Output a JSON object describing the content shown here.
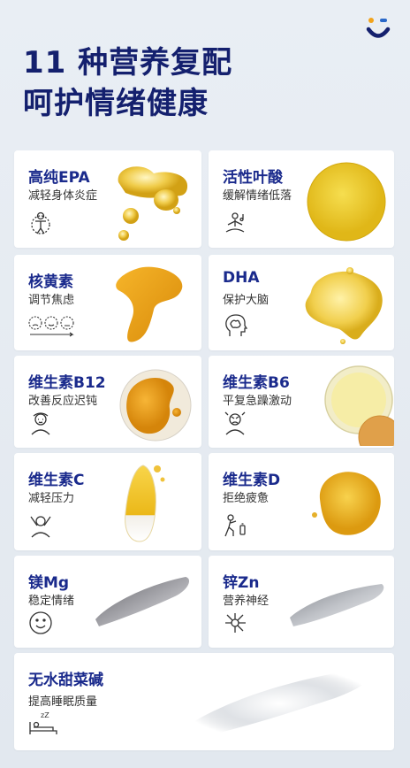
{
  "header": {
    "line1": "11 种营养复配",
    "line2": "呵护情绪健康"
  },
  "colors": {
    "brand": "#14206e",
    "accent_orange": "#f2a31b",
    "accent_blue": "#2a68c8"
  },
  "nutrients": [
    {
      "name": "高纯EPA",
      "desc": "减轻身体炎症",
      "icon": "body-inflammation-icon"
    },
    {
      "name": "活性叶酸",
      "desc": "缓解情绪低落",
      "icon": "meditation-icon"
    },
    {
      "name": "核黄素",
      "desc": "调节焦虑",
      "icon": "mood-faces-icon"
    },
    {
      "name": "DHA",
      "desc": "保护大脑",
      "icon": "brain-head-icon"
    },
    {
      "name": "维生素B12",
      "desc": "改善反应迟钝",
      "icon": "confused-person-icon"
    },
    {
      "name": "维生素B6",
      "desc": "平复急躁激动",
      "icon": "angry-person-icon"
    },
    {
      "name": "维生素C",
      "desc": "减轻压力",
      "icon": "stressed-person-icon"
    },
    {
      "name": "维生素D",
      "desc": "拒绝疲惫",
      "icon": "tired-walker-icon"
    },
    {
      "name": "镁Mg",
      "desc": "稳定情绪",
      "icon": "smile-icon"
    },
    {
      "name": "锌Zn",
      "desc": "营养神经",
      "icon": "neuron-icon"
    },
    {
      "name": "无水甜菜碱",
      "desc": "提高睡眠质量",
      "icon": "sleep-bed-icon"
    }
  ]
}
